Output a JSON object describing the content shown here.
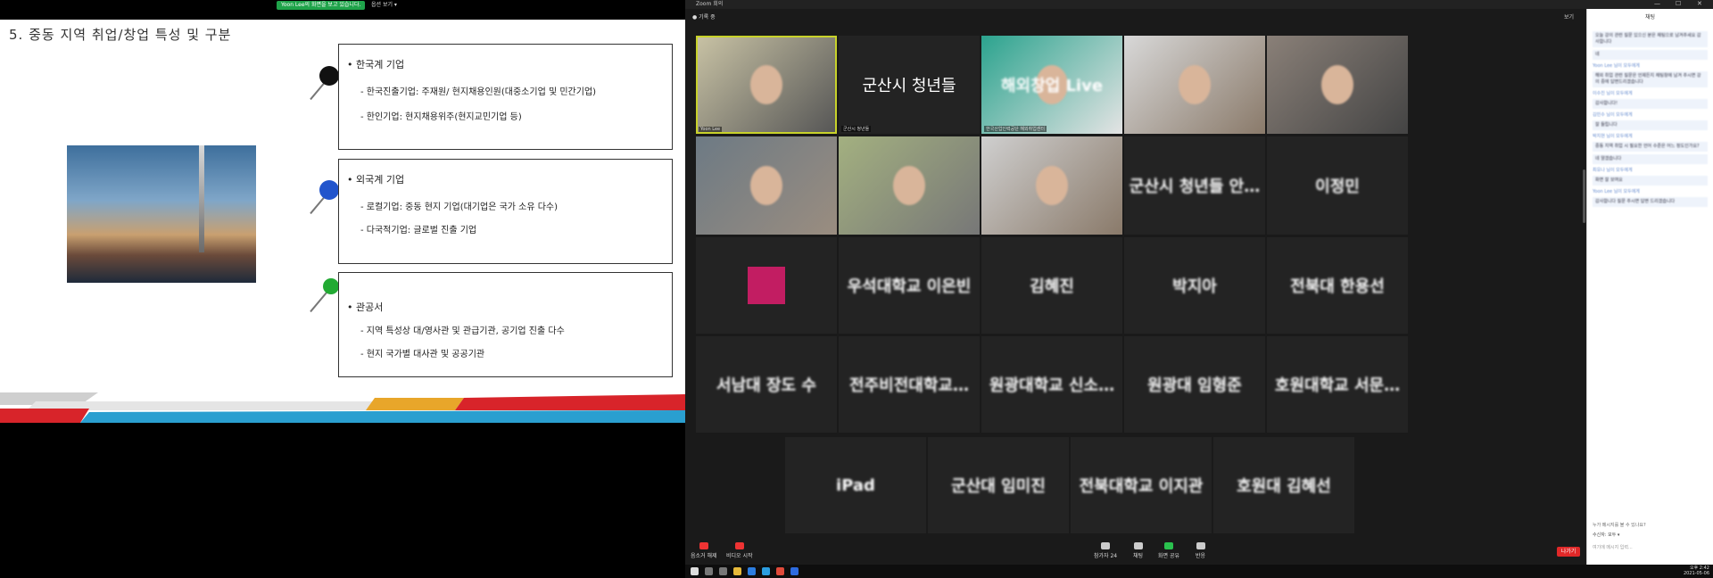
{
  "share": {
    "badge": "Yoon Lee의 화면을 보고 있습니다.",
    "view_options": "옵션 보기 ▾"
  },
  "slide": {
    "title": "5. 중동 지역 취업/창업 특성 및 구분",
    "sections": [
      {
        "heading": "한국계 기업",
        "items": [
          "- 한국진출기업: 주재원/ 현지채용인원(대중소기업 및 민간기업)",
          "- 한인기업: 현지채용위주(현지교민기업 등)"
        ],
        "pin_color": "#111111"
      },
      {
        "heading": "외국계 기업",
        "items": [
          "- 로컬기업: 중동 현지 기업(대기업은 국가 소유 다수)",
          "- 다국적기업: 글로벌 진출 기업"
        ],
        "pin_color": "#2255cc"
      },
      {
        "heading": "관공서",
        "items": [
          "- 지역 특성상 대/영사관 및 관급기관, 공기업 진출 다수",
          "- 현지 국가별 대사관 및 공공기관"
        ],
        "pin_color": "#22aa33"
      }
    ],
    "bullet_glyph": "•"
  },
  "zoom": {
    "title": "Zoom 회의",
    "rec": "● 기록 중",
    "view": "보기",
    "controls": [
      "—",
      "☐",
      "✕"
    ],
    "tiles": [
      {
        "name": "Yoon Lee",
        "text": "",
        "kind": "video",
        "colors": [
          "#c9c3a5",
          "#555"
        ]
      },
      {
        "name": "군산시 청년들",
        "text": "군산시 청년들",
        "kind": "textclear"
      },
      {
        "name": "한국산업인력공단 해외취업센터",
        "text": "해외창업 Live",
        "kind": "video",
        "colors": [
          "#2ba38e",
          "#e4e4e4"
        ]
      },
      {
        "name": "",
        "text": "",
        "kind": "video",
        "colors": [
          "#d8d8d8",
          "#8a7a6a"
        ]
      },
      {
        "name": "",
        "text": "",
        "kind": "video",
        "colors": [
          "#8a8078",
          "#444"
        ]
      },
      {
        "name": "",
        "text": "",
        "kind": "video",
        "colors": [
          "#6d7a84",
          "#9a8d80"
        ]
      },
      {
        "name": "",
        "text": "",
        "kind": "video",
        "colors": [
          "#a3b080",
          "#777"
        ]
      },
      {
        "name": "",
        "text": "",
        "kind": "video",
        "colors": [
          "#cfcfcf",
          "#8a7a6a"
        ]
      },
      {
        "name": "",
        "text": "군산시 청년들 안…",
        "kind": "text"
      },
      {
        "name": "",
        "text": "이정민",
        "kind": "text"
      },
      {
        "name": "",
        "text": "",
        "kind": "avatar"
      },
      {
        "name": "",
        "text": "우석대학교 이은빈",
        "kind": "text"
      },
      {
        "name": "",
        "text": "김혜진",
        "kind": "text"
      },
      {
        "name": "",
        "text": "박지아",
        "kind": "text"
      },
      {
        "name": "",
        "text": "전북대 한용선",
        "kind": "text"
      },
      {
        "name": "",
        "text": "서남대 장도 수",
        "kind": "text"
      },
      {
        "name": "",
        "text": "전주비전대학교…",
        "kind": "text"
      },
      {
        "name": "",
        "text": "원광대학교 신소…",
        "kind": "text"
      },
      {
        "name": "",
        "text": "원광대 임형준",
        "kind": "text"
      },
      {
        "name": "",
        "text": "호원대학교 서문…",
        "kind": "text"
      },
      {
        "name": "",
        "text": "iPad",
        "kind": "text"
      },
      {
        "name": "",
        "text": "군산대 임미진",
        "kind": "text"
      },
      {
        "name": "",
        "text": "전북대학교 이지관",
        "kind": "text"
      },
      {
        "name": "",
        "text": "호원대 김혜선",
        "kind": "text"
      }
    ],
    "toolbar": {
      "mute": "음소거 해제",
      "video": "비디오 시작",
      "participants": "참가자",
      "participants_count": "24",
      "chat": "채팅",
      "share": "화면 공유",
      "reactions": "반응",
      "leave": "나가기"
    },
    "chat": {
      "header": "채팅",
      "messages": [
        "오늘 강의 관련 질문 있으신 분은 채팅으로 남겨주세요 감사합니다",
        "네",
        "Yoon Lee 님이 모두에게",
        "해외 취업 관련 질문은 언제든지 채팅창에 남겨 주시면 강의 중에 답변드리겠습니다",
        "이수진 님이 모두에게",
        "감사합니다!",
        "김민수 님이 모두에게",
        "잘 들립니다",
        "박지현 님이 모두에게",
        "중동 지역 취업 시 필요한 언어 수준은 어느 정도인가요?",
        "네 알겠습니다",
        "최유나 님이 모두에게",
        "화면 잘 보여요",
        "Yoon Lee 님이 모두에게",
        "감사합니다 질문 주시면 답변 드리겠습니다"
      ],
      "footer_note": "누가 메시지를 볼 수 있나요?",
      "to_label": "수신자:",
      "to_value": "모두 ▾",
      "input_placeholder": "여기에 메시지 입력..."
    },
    "clock": {
      "time": "오후 2:42",
      "date": "2021-05-06"
    }
  }
}
